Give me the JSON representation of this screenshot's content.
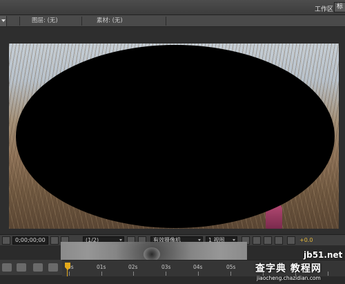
{
  "workspace": {
    "label": "工作区:",
    "value": "标"
  },
  "tabs": [
    {
      "label": "图层: (无)"
    },
    {
      "label": "素材: (无)"
    }
  ],
  "viewer": {
    "timecode": "0;00;00;00",
    "resolution": "(1/2)",
    "camera": "有效摄像机",
    "views": "1 视图",
    "exposure": "+0.0"
  },
  "timeline": {
    "ticks": [
      "0s",
      "01s",
      "02s",
      "03s",
      "04s",
      "05s"
    ]
  },
  "watermark": {
    "line1": "jb51.net",
    "line2": "查字典 教程网",
    "line3": "jiaocheng.chazidian.com"
  }
}
